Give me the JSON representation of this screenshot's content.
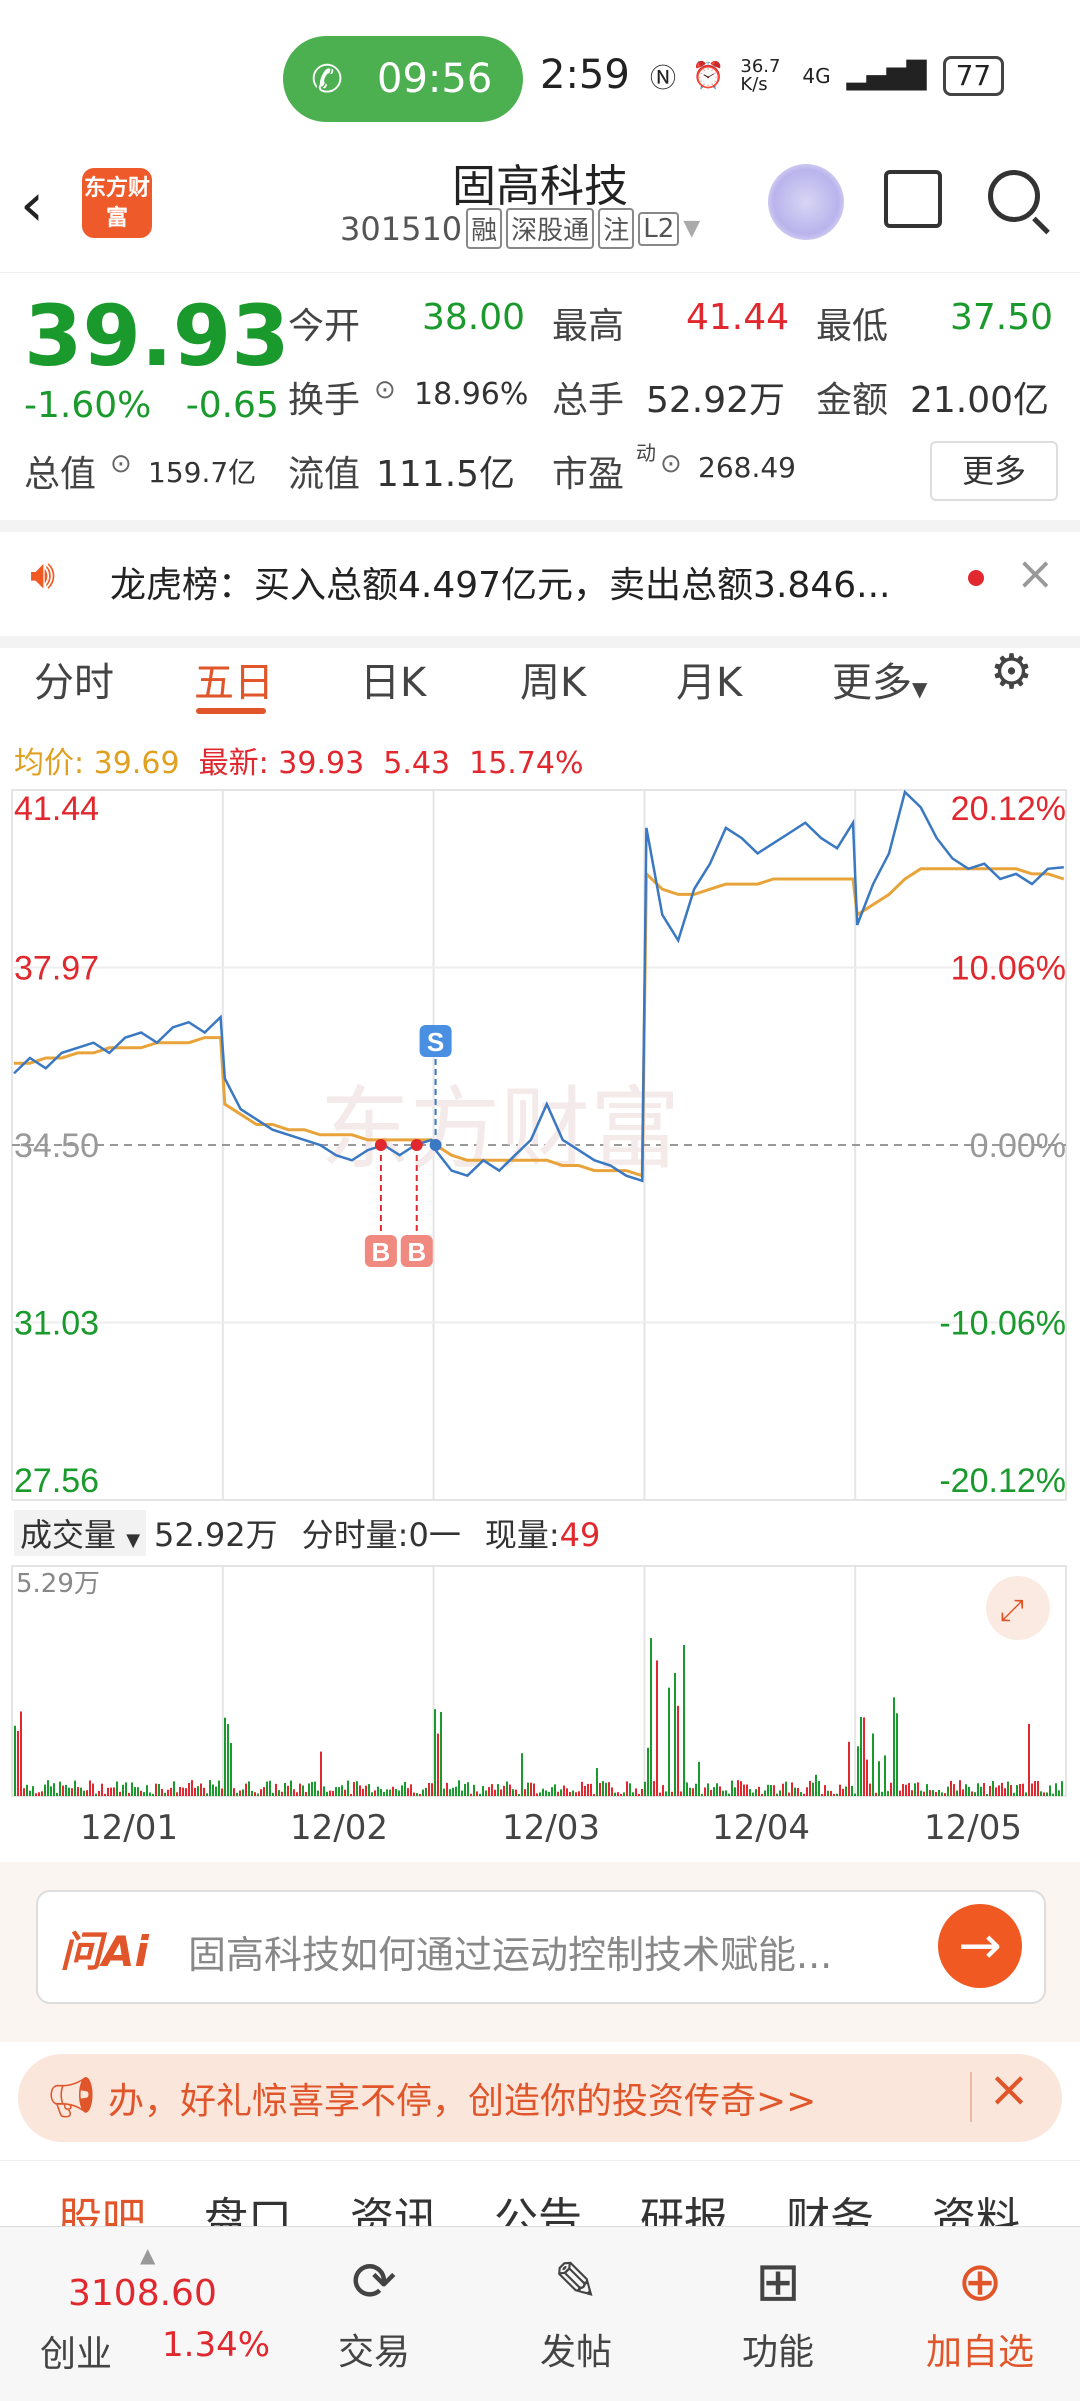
{
  "status_bar": {
    "call_time": "09:56",
    "time": "2:59",
    "net_speed": "36.7 K/s",
    "network": "4G",
    "battery": "77",
    "call_badge": "1"
  },
  "header": {
    "title": "固高科技",
    "code": "301510",
    "tags": [
      "融",
      "深股通",
      "注",
      "L2"
    ],
    "logo_text": "东方财富"
  },
  "quote": {
    "price": "39.93",
    "change_pct": "-1.60%",
    "change": "-0.65",
    "open_label": "今开",
    "open": "38.00",
    "high_label": "最高",
    "high": "41.44",
    "low_label": "最低",
    "low": "37.50",
    "turnover_label": "换手",
    "turnover": "18.96%",
    "volume_label": "总手",
    "volume": "52.92万",
    "amount_label": "金额",
    "amount": "21.00亿",
    "mktcap_label": "总值",
    "mktcap": "159.7亿",
    "float_label": "流值",
    "float": "111.5亿",
    "pe_label": "市盈",
    "pe_sup": "动",
    "pe": "268.49",
    "more": "更多"
  },
  "news": {
    "text": "龙虎榜：买入总额4.497亿元，卖出总额3.846..."
  },
  "tabs": [
    "分时",
    "五日",
    "日K",
    "周K",
    "月K",
    "更多"
  ],
  "info_line": {
    "avg_label": "均价:",
    "avg": "39.69",
    "latest_label": "最新:",
    "latest": "39.93",
    "chg": "5.43",
    "pct": "15.74%"
  },
  "chart_data": {
    "type": "line",
    "title": "",
    "y_left_ticks": [
      "41.44",
      "37.97",
      "34.50",
      "31.03",
      "27.56"
    ],
    "y_right_ticks": [
      "20.12%",
      "10.06%",
      "0.00%",
      "-10.06%",
      "-20.12%"
    ],
    "x_labels": [
      "12/01",
      "12/02",
      "12/03",
      "12/04",
      "12/05"
    ],
    "ylim": [
      27.56,
      41.44
    ],
    "prev_close": 34.5,
    "series": [
      {
        "name": "价格",
        "values": [
          35.9,
          36.2,
          36.0,
          36.3,
          36.4,
          36.5,
          36.3,
          36.6,
          36.7,
          36.5,
          36.8,
          36.9,
          36.7,
          37.0,
          35.8,
          35.2,
          35.0,
          34.8,
          34.7,
          34.6,
          34.5,
          34.3,
          34.2,
          34.4,
          34.5,
          34.3,
          34.5,
          34.6,
          34.4,
          34.0,
          33.9,
          34.2,
          34.0,
          34.3,
          34.6,
          35.3,
          34.6,
          34.4,
          34.2,
          34.1,
          33.9,
          33.8,
          40.7,
          39.0,
          38.5,
          39.5,
          40.0,
          40.7,
          40.5,
          40.2,
          40.4,
          40.6,
          40.8,
          40.5,
          40.3,
          40.8,
          38.8,
          39.6,
          40.2,
          41.4,
          41.1,
          40.5,
          40.1,
          39.9,
          40.0,
          39.7,
          39.8,
          39.6,
          39.9,
          39.93
        ]
      },
      {
        "name": "均价",
        "values": [
          36.1,
          36.1,
          36.2,
          36.2,
          36.3,
          36.3,
          36.4,
          36.4,
          36.4,
          36.5,
          36.5,
          36.5,
          36.6,
          36.6,
          35.3,
          35.1,
          34.9,
          34.9,
          34.8,
          34.8,
          34.7,
          34.7,
          34.7,
          34.6,
          34.6,
          34.6,
          34.6,
          34.6,
          34.5,
          34.3,
          34.2,
          34.2,
          34.2,
          34.2,
          34.2,
          34.2,
          34.1,
          34.1,
          34.0,
          34.0,
          34.0,
          33.9,
          39.8,
          39.5,
          39.4,
          39.4,
          39.5,
          39.6,
          39.6,
          39.6,
          39.7,
          39.7,
          39.7,
          39.7,
          39.7,
          39.7,
          39.0,
          39.2,
          39.4,
          39.7,
          39.9,
          39.9,
          39.9,
          39.9,
          39.9,
          39.9,
          39.9,
          39.8,
          39.8,
          39.7
        ]
      }
    ],
    "markers": [
      {
        "label": "S"
      },
      {
        "label": "B"
      },
      {
        "label": "B"
      }
    ]
  },
  "volume": {
    "label": "成交量",
    "total": "52.92万",
    "tick_label": "分时量:",
    "tick_value": "0一",
    "now_label": "现量:",
    "now_value": "49",
    "max": "5.29万"
  },
  "ask_ai": {
    "logo": "问Ai",
    "text": "固高科技如何通过运动控制技术赋能..."
  },
  "promo": {
    "text": "办，好礼惊喜享不停，创造你的投资传奇>>"
  },
  "community_tabs": [
    "股吧",
    "盘口",
    "资讯",
    "公告",
    "研报",
    "财务",
    "资料"
  ],
  "bottom_nav": {
    "index_value": "3108.60",
    "index_name": "创业",
    "index_pct": "1.34%",
    "items": [
      {
        "label": "交易",
        "icon": "yen-cycle-icon"
      },
      {
        "label": "发帖",
        "icon": "edit-icon"
      },
      {
        "label": "功能",
        "icon": "grid-icon"
      },
      {
        "label": "加自选",
        "icon": "plus-circle-icon"
      }
    ]
  }
}
